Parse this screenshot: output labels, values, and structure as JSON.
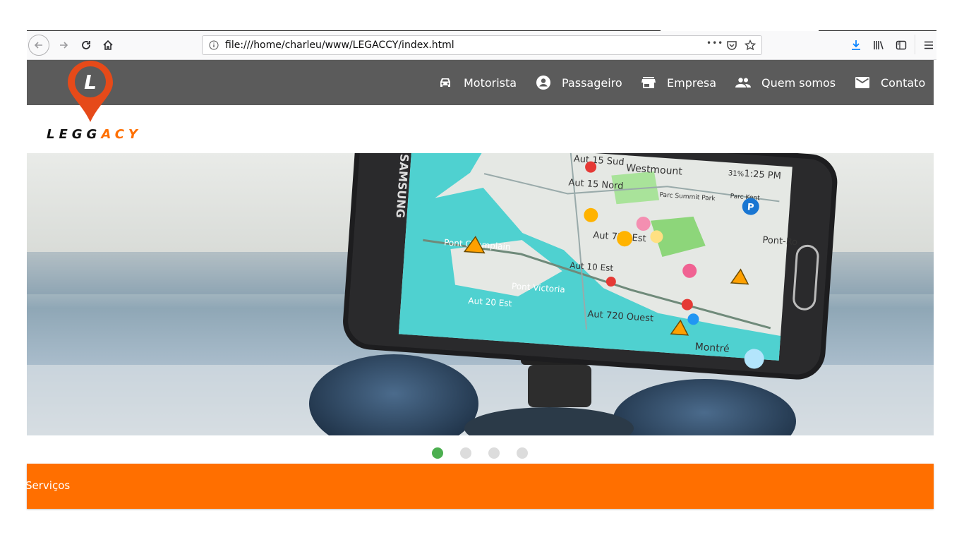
{
  "browser": {
    "url": "file:///home/charleu/www/LEGACCY/index.html",
    "more_label": "•••"
  },
  "site": {
    "logo": {
      "letter": "L",
      "word_dark": "LEGG",
      "word_accent": "ACY"
    },
    "nav": [
      {
        "label": "Motorista",
        "icon": "car-icon"
      },
      {
        "label": "Passageiro",
        "icon": "account-circle-icon"
      },
      {
        "label": "Empresa",
        "icon": "store-icon"
      },
      {
        "label": "Quem somos",
        "icon": "people-icon"
      },
      {
        "label": "Contato",
        "icon": "mail-icon"
      }
    ],
    "slider": {
      "active_index": 0,
      "count": 4
    },
    "services_label": "Serviços",
    "phone": {
      "status_time": "1:25 PM",
      "status_battery": "31%",
      "brand": "SAMSUNG",
      "map_labels": [
        "Aut 15 Sud",
        "Westmount",
        "Aut 15 Nord",
        "Parc Summit Park",
        "Parc Kent",
        "Aut 720 Est",
        "Pont Champlain",
        "Aut 10 Est",
        "Pont-Ro",
        "Pont Victoria",
        "Aut 20 Est",
        "Aut 720 Ouest",
        "Montré"
      ]
    }
  },
  "colors": {
    "nav_bg": "#5b5b5b",
    "accent": "#ff6f00",
    "active_dot": "#4caf50"
  }
}
